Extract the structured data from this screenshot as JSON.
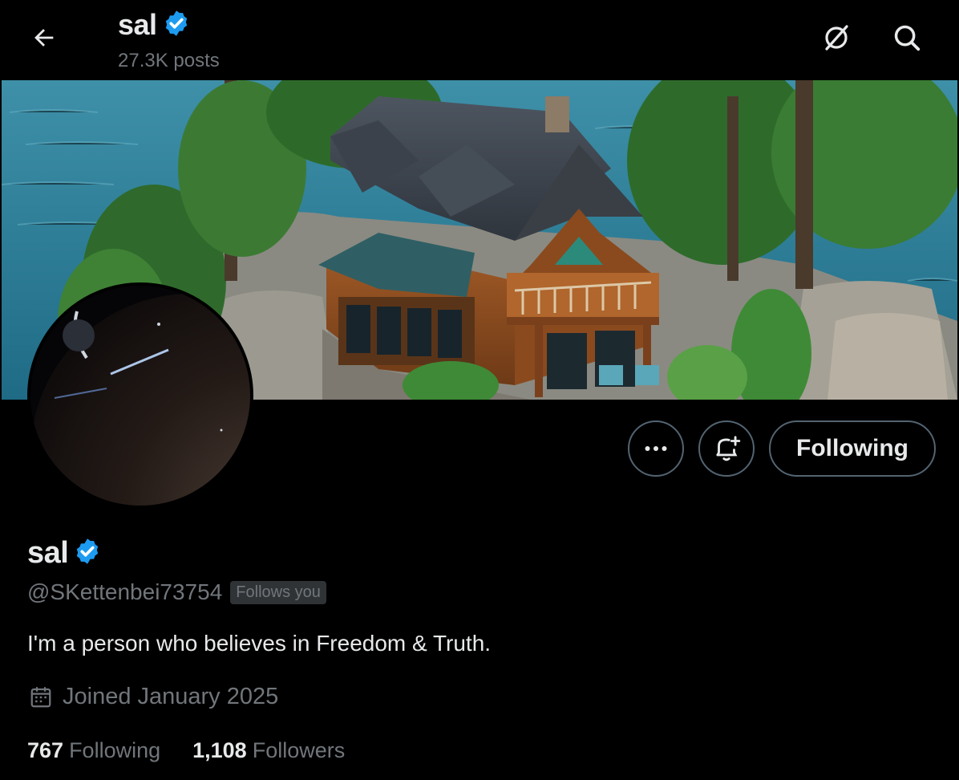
{
  "header": {
    "name": "sal",
    "posts_count": "27.3K posts"
  },
  "profile": {
    "name": "sal",
    "handle": "@SKettenbei73754",
    "follows_you_badge": "Follows you",
    "bio": "I'm a person who believes in Freedom & Truth.",
    "joined": "Joined January 2025"
  },
  "actions": {
    "following_label": "Following"
  },
  "stats": {
    "following_count": "767",
    "following_label": "Following",
    "followers_count": "1,108",
    "followers_label": "Followers"
  },
  "colors": {
    "verified_blue": "#1d9bf0",
    "text_primary": "#e7e9ea",
    "text_secondary": "#71767b",
    "button_border": "#536471"
  },
  "icons": [
    "back-arrow-icon",
    "grok-icon",
    "search-icon",
    "verified-badge-icon",
    "more-icon",
    "notify-bell-icon",
    "calendar-icon"
  ]
}
